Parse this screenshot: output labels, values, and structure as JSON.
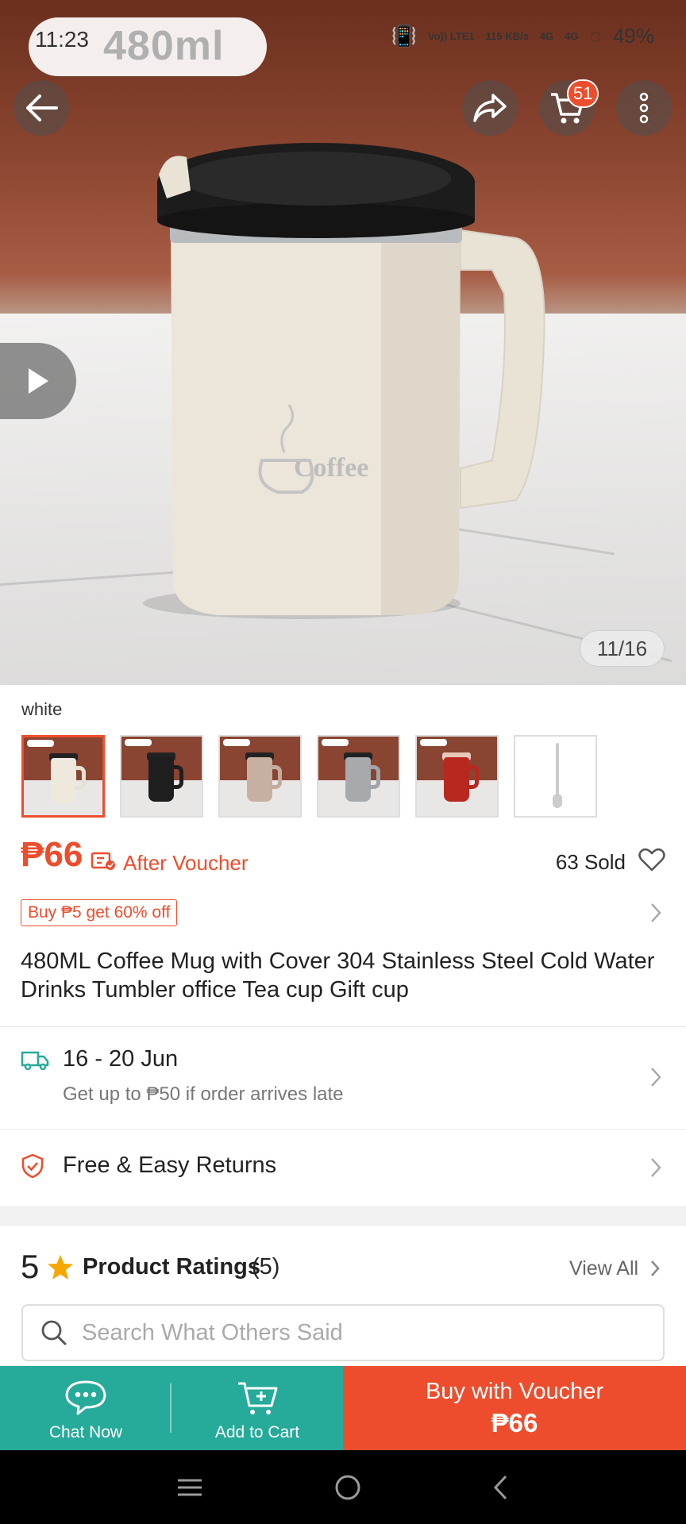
{
  "status_bar": {
    "time": "11:23",
    "size_overlay": "480ml",
    "network": "Vo)) LTE1",
    "speed": "115 KB/s",
    "signal1": "4G",
    "signal2": "4G",
    "battery": "49%"
  },
  "hero": {
    "cart_count": "51",
    "image_counter": "11/16",
    "cup_logo": "Coffee"
  },
  "variant": {
    "selected_label": "white",
    "options": [
      {
        "name": "white",
        "color": "#efe9dd",
        "handle": "#e7e1d4",
        "selected": true
      },
      {
        "name": "black",
        "color": "#1e1e1e",
        "handle": "#1e1e1e",
        "selected": false
      },
      {
        "name": "khaki",
        "color": "#c7b0a2",
        "handle": "#c3ac9e",
        "selected": false
      },
      {
        "name": "grey",
        "color": "#a7a9ac",
        "handle": "#a2a4a7",
        "selected": false
      },
      {
        "name": "red",
        "color": "#b8281f",
        "handle": "#b8281f",
        "selected": false
      },
      {
        "name": "spoon",
        "color": "#ffffff",
        "handle": "#ffffff",
        "selected": false
      }
    ]
  },
  "price": {
    "amount": "₱66",
    "after_voucher": "After Voucher",
    "sold": "63 Sold"
  },
  "promo": {
    "label": "Buy ₱5 get 60% off"
  },
  "product": {
    "title": "480ML Coffee Mug with Cover 304 Stainless Steel Cold Water Drinks Tumbler office Tea cup Gift cup"
  },
  "delivery": {
    "date_range": "16 - 20 Jun",
    "guarantee": "Get up to ₱50 if order arrives late"
  },
  "returns": {
    "label": "Free & Easy Returns"
  },
  "ratings": {
    "score": "5",
    "title": "Product Ratings",
    "count": "(5)",
    "view_all": "View All",
    "search_placeholder": "Search What Others Said"
  },
  "action_bar": {
    "chat_label": "Chat Now",
    "cart_label": "Add to Cart",
    "buy_label": "Buy with Voucher",
    "buy_price": "₱66"
  },
  "colors": {
    "accent": "#ee4d2d",
    "teal": "#26aa99"
  }
}
